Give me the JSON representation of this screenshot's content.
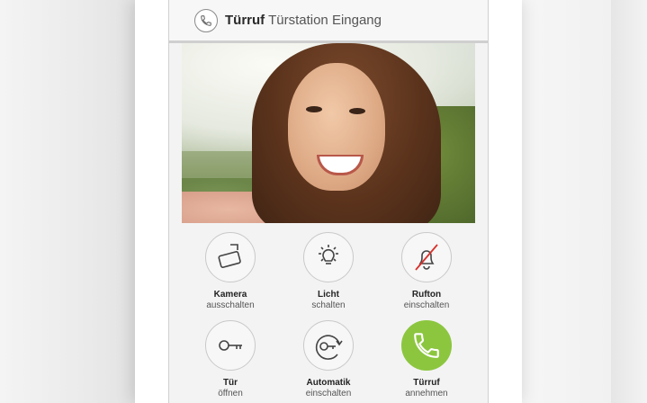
{
  "header": {
    "title_bold": "Türruf",
    "title_rest": "Türstation Eingang",
    "icon": "phone-icon"
  },
  "controls": [
    {
      "id": "camera",
      "icon": "camera-icon",
      "line1": "Kamera",
      "line2": "ausschalten",
      "active": false
    },
    {
      "id": "light",
      "icon": "light-bulb-icon",
      "line1": "Licht",
      "line2": "schalten",
      "active": false
    },
    {
      "id": "ringtone",
      "icon": "bell-muted-icon",
      "line1": "Rufton",
      "line2": "einschalten",
      "active": false
    },
    {
      "id": "door",
      "icon": "key-icon",
      "line1": "Tür",
      "line2": "öffnen",
      "active": false
    },
    {
      "id": "auto",
      "icon": "auto-key-icon",
      "line1": "Automatik",
      "line2": "einschalten",
      "active": false
    },
    {
      "id": "call",
      "icon": "phone-icon",
      "line1": "Türruf",
      "line2": "annehmen",
      "active": true
    }
  ],
  "colors": {
    "accept_green": "#8cc63f",
    "mute_red": "#d9312b"
  }
}
